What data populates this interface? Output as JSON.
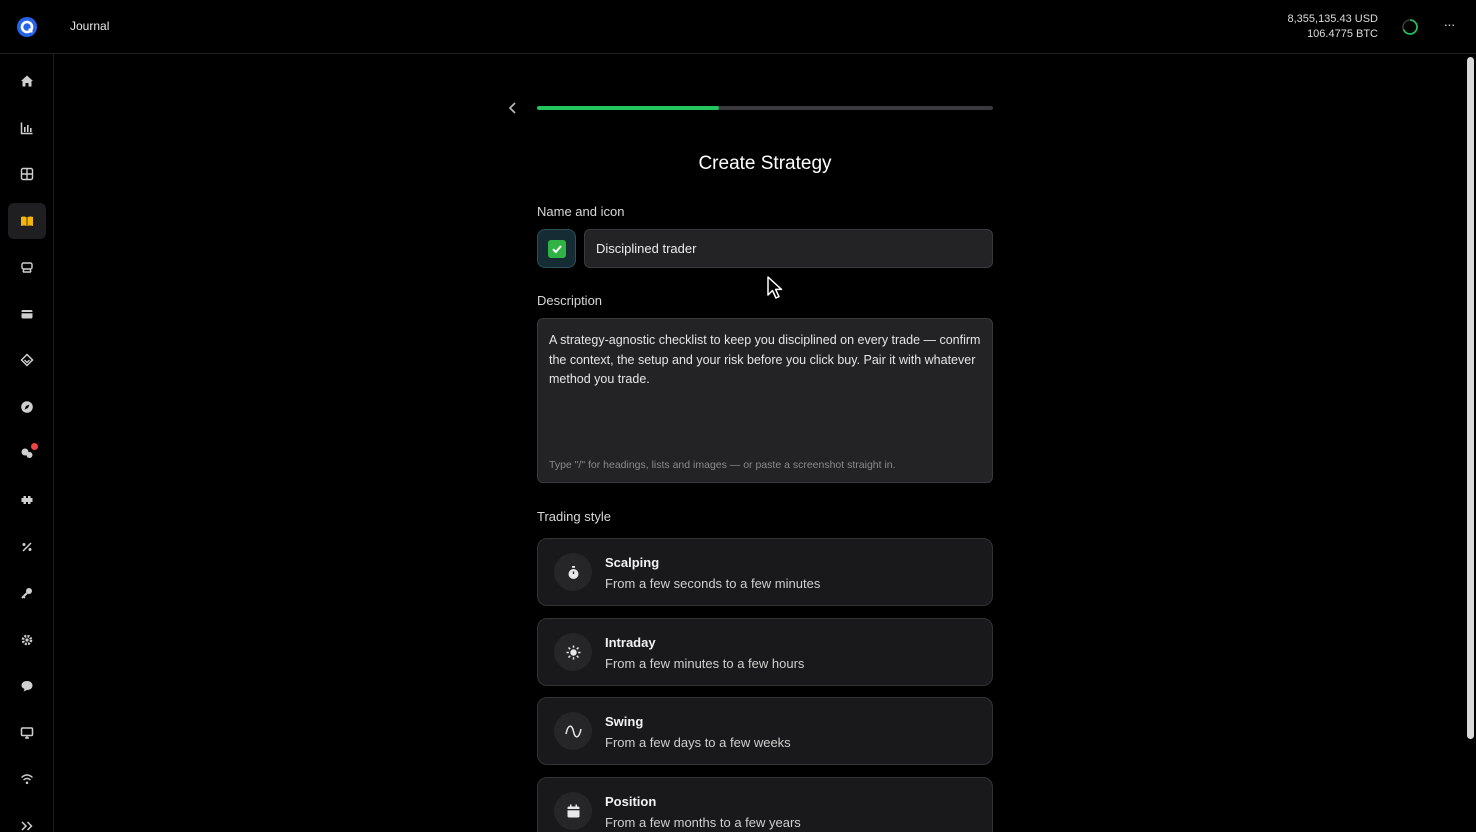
{
  "app": {
    "title": "Journal",
    "balance_usd": "8,355,135.43 USD",
    "balance_btc": "106.4775 BTC",
    "more_label": "···"
  },
  "sidebar": {
    "items": [
      {
        "name": "home-icon"
      },
      {
        "name": "chart-icon"
      },
      {
        "name": "grid-icon"
      },
      {
        "name": "journal-book-icon",
        "active": true
      },
      {
        "name": "trades-icon"
      },
      {
        "name": "wallet-icon"
      },
      {
        "name": "tag-icon"
      },
      {
        "name": "compass-icon"
      },
      {
        "name": "community-icon",
        "badge": true
      },
      {
        "name": "puzzle-icon"
      },
      {
        "name": "percent-icon"
      },
      {
        "name": "key-icon"
      },
      {
        "name": "settings-icon"
      },
      {
        "name": "support-chat-icon"
      },
      {
        "name": "monitor-icon"
      },
      {
        "name": "wifi-icon"
      },
      {
        "name": "expand-icon"
      }
    ]
  },
  "wizard": {
    "progress": 0.4,
    "title": "Create Strategy",
    "name_label": "Name and icon",
    "name_value": "Disciplined trader",
    "strategy_icon": "check-mark-emoji",
    "description_label": "Description",
    "description_value": "A strategy-agnostic checklist to keep you disciplined on every trade — confirm the context, the setup and your risk before you click buy. Pair it with whatever method you trade.",
    "description_hint": "Type \"/\" for headings, lists and images — or paste a screenshot straight in.",
    "trading_style_label": "Trading style",
    "styles": [
      {
        "icon": "stopwatch-icon",
        "name": "Scalping",
        "desc": "From a few seconds to a few minutes"
      },
      {
        "icon": "sun-icon",
        "name": "Intraday",
        "desc": "From a few minutes to a few hours"
      },
      {
        "icon": "wave-icon",
        "name": "Swing",
        "desc": "From a few days to a few weeks"
      },
      {
        "icon": "calendar-icon",
        "name": "Position",
        "desc": "From a few months to a few years"
      }
    ]
  },
  "colors": {
    "accent_green": "#22c55e",
    "brand_blue": "#2563eb",
    "badge_red": "#ef4444"
  }
}
